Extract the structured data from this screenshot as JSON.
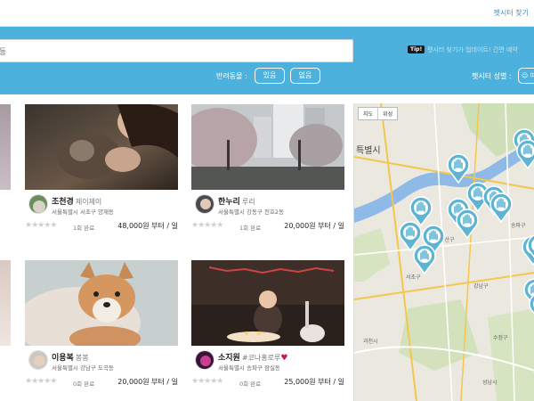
{
  "header": {
    "find_link": "펫시터 찾기"
  },
  "search": {
    "value": "동"
  },
  "tip": {
    "badge": "Tip!",
    "text": "펫시터 찾기가 업데이트! 간편 예약"
  },
  "filters": {
    "pet_label": "반려동물 :",
    "yes_label": "있음",
    "no_label": "없음",
    "gender_label": "펫시터 성별 :",
    "gender_value": "여"
  },
  "cards": [
    {
      "name": "조천경",
      "nick": "제이제이",
      "address": "서울특별시 서초구 양재동",
      "reviews": "1회 완료",
      "price": "48,000원 부터 / 일"
    },
    {
      "name": "한누리",
      "nick": "루리",
      "address": "서울특별시 강동구 천호2동",
      "reviews": "1회 완료",
      "price": "20,000원 부터 / 일"
    },
    {
      "name": "이용복",
      "nick": "봉봉",
      "address": "서울특별시 강남구 도곡동",
      "reviews": "0회 완료",
      "price": "20,000원 부터 / 일"
    },
    {
      "name": "소지원",
      "nick": "#코나홍로루",
      "heart": "♥",
      "address": "서울특별시 송파구 잠실동",
      "reviews": "0회 완료",
      "price": "25,000원 부터 / 일"
    }
  ],
  "stars": "★★★★★",
  "map": {
    "tab_map": "지도",
    "tab_satellite": "위성",
    "city": "특별시",
    "labels": {
      "yongsan": "용산구",
      "gwacheon": "과천시",
      "suwon_hint": "수정구",
      "seocho": "서초구",
      "songpa": "송파구",
      "gangnam": "강남구",
      "seongnam": "성남시"
    }
  },
  "colors": {
    "accent": "#4cb2dd",
    "link": "#3a95c9",
    "pin": "#5fb4d3"
  }
}
